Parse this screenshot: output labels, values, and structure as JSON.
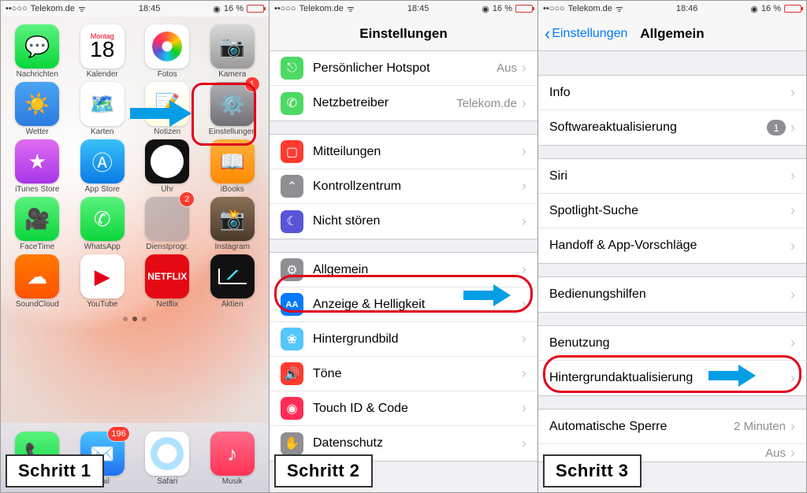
{
  "status": {
    "carrier": "Telekom.de",
    "time1": "18:45",
    "time3": "18:46",
    "battery": "16 %"
  },
  "steps": {
    "s1": "Schritt 1",
    "s2": "Schritt 2",
    "s3": "Schritt 3"
  },
  "home": {
    "apps": [
      {
        "label": "Nachrichten"
      },
      {
        "label": "Kalender",
        "day": "18",
        "weekday": "Montag"
      },
      {
        "label": "Fotos"
      },
      {
        "label": "Kamera"
      },
      {
        "label": "Wetter"
      },
      {
        "label": "Karten"
      },
      {
        "label": "Notizen"
      },
      {
        "label": "Einstellungen",
        "badge": "1"
      },
      {
        "label": "iTunes Store"
      },
      {
        "label": "App Store"
      },
      {
        "label": "Uhr"
      },
      {
        "label": "iBooks"
      },
      {
        "label": "FaceTime"
      },
      {
        "label": "WhatsApp"
      },
      {
        "label": "Dienstprogr.",
        "badge": "2"
      },
      {
        "label": "Instagram"
      },
      {
        "label": "SoundCloud"
      },
      {
        "label": "YouTube"
      },
      {
        "label": "Netflix"
      },
      {
        "label": "Aktien"
      }
    ],
    "dock": [
      {
        "label": "Telefon"
      },
      {
        "label": "Mail",
        "badge": "196"
      },
      {
        "label": "Safari"
      },
      {
        "label": "Musik"
      }
    ]
  },
  "settings": {
    "title": "Einstellungen",
    "g1": [
      {
        "label": "Persönlicher Hotspot",
        "value": "Aus"
      },
      {
        "label": "Netzbetreiber",
        "value": "Telekom.de"
      }
    ],
    "g2": [
      {
        "label": "Mitteilungen"
      },
      {
        "label": "Kontrollzentrum"
      },
      {
        "label": "Nicht stören"
      }
    ],
    "g3": [
      {
        "label": "Allgemein"
      },
      {
        "label": "Anzeige & Helligkeit"
      },
      {
        "label": "Hintergrundbild"
      },
      {
        "label": "Töne"
      },
      {
        "label": "Touch ID & Code"
      },
      {
        "label": "Datenschutz"
      }
    ]
  },
  "general": {
    "back": "Einstellungen",
    "title": "Allgemein",
    "g1": [
      {
        "label": "Info"
      },
      {
        "label": "Softwareaktualisierung",
        "count": "1"
      }
    ],
    "g2": [
      {
        "label": "Siri"
      },
      {
        "label": "Spotlight-Suche"
      },
      {
        "label": "Handoff & App-Vorschläge"
      }
    ],
    "g3": [
      {
        "label": "Bedienungshilfen"
      }
    ],
    "g4": [
      {
        "label": "Benutzung"
      },
      {
        "label": "Hintergrundaktualisierung"
      }
    ],
    "g5": [
      {
        "label": "Automatische Sperre",
        "value": "2 Minuten"
      }
    ],
    "aus": "Aus"
  }
}
